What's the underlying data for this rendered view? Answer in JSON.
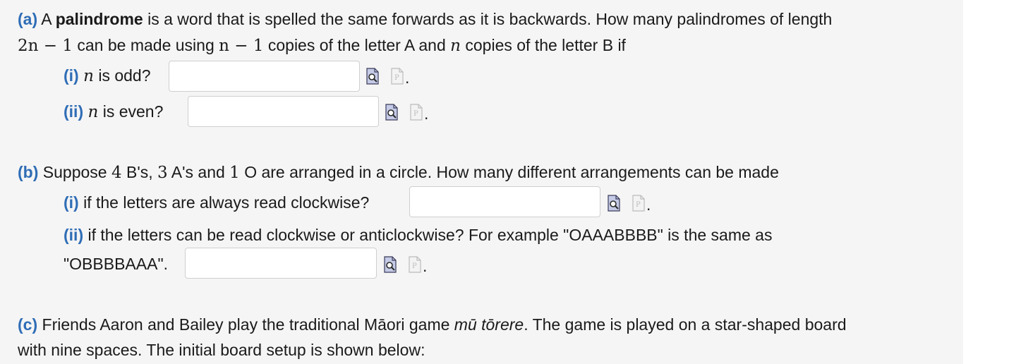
{
  "part_a": {
    "label": "(a)",
    "intro_pre": "A ",
    "bold_word": "palindrome",
    "intro_post": " is a word that is spelled the same forwards as it is backwards. How many palindromes of length",
    "line2_expr1": "2n − 1",
    "line2_t1": " can be made using ",
    "line2_expr2": "n − 1",
    "line2_t2": " copies of the letter A and ",
    "line2_var": "n",
    "line2_t3": " copies of the letter B if",
    "i_label": "(i)",
    "i_var": "n",
    "i_text": " is odd?",
    "ii_label": "(ii)",
    "ii_var": "n",
    "ii_text": " is even?"
  },
  "part_b": {
    "label": "(b)",
    "t1": " Suppose ",
    "n1": "4",
    "t2": " B's, ",
    "n2": "3",
    "t3": " A's and ",
    "n3": "1",
    "t4": " O are arranged in a circle. How many different arrangements can be made",
    "i_label": "(i)",
    "i_text": " if the letters are always read clockwise?",
    "ii_label": "(ii)",
    "ii_text": " if the letters can be read clockwise or anticlockwise? For example \"OAAABBBB\" is the same as",
    "ii_text2": "\"OBBBBAAA\"."
  },
  "part_c": {
    "label": "(c)",
    "t1": " Friends Aaron and Bailey play the traditional Māori game ",
    "game": "mū tōrere",
    "t2": ". The game is played on a star-shaped board",
    "line2": "with nine spaces. The initial board setup is shown below:"
  },
  "punct": "."
}
